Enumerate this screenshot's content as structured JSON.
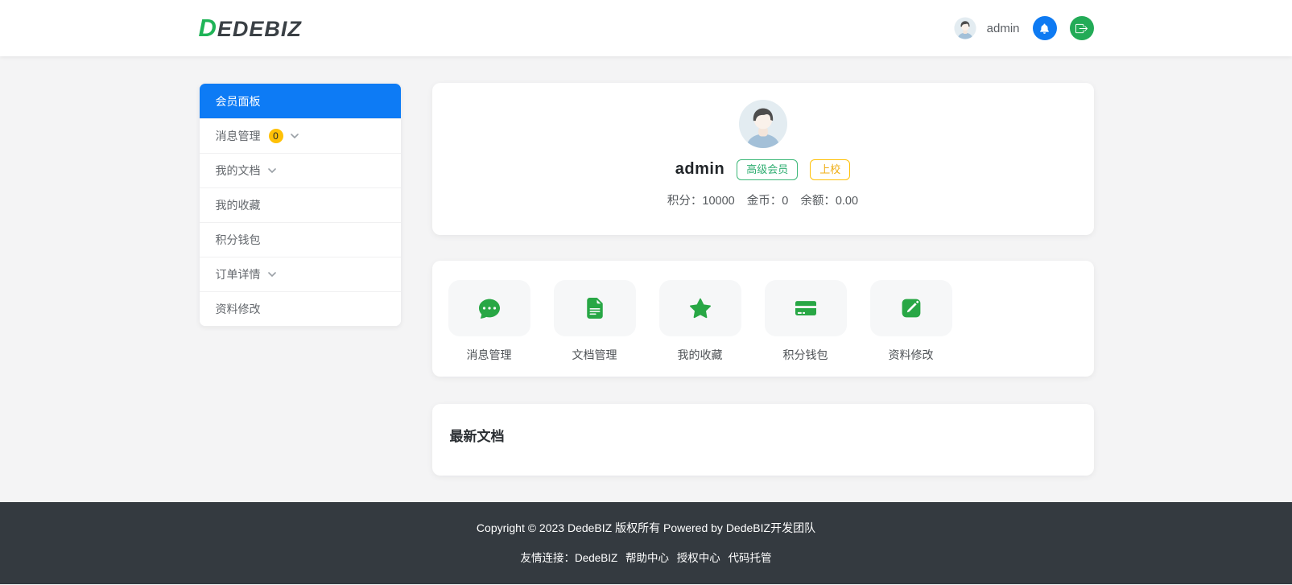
{
  "header": {
    "logo": {
      "d": "D",
      "rest": "EDEBIZ"
    },
    "username": "admin"
  },
  "sidebar": {
    "items": [
      {
        "label": "会员面板",
        "active": true
      },
      {
        "label": "消息管理",
        "badge": "0",
        "chevron": true
      },
      {
        "label": "我的文档",
        "chevron": true
      },
      {
        "label": "我的收藏"
      },
      {
        "label": "积分钱包"
      },
      {
        "label": "订单详情",
        "chevron": true
      },
      {
        "label": "资料修改"
      }
    ]
  },
  "profile": {
    "username": "admin",
    "badges": [
      {
        "label": "高级会员",
        "color": "#3cb878"
      },
      {
        "label": "上校",
        "color": "#ffc107"
      }
    ],
    "stats": [
      {
        "label": "积分：",
        "value": "10000"
      },
      {
        "label": "金币：",
        "value": "0"
      },
      {
        "label": "余额：",
        "value": "0.00"
      }
    ]
  },
  "shortcuts": [
    {
      "label": "消息管理",
      "icon": "chat-icon"
    },
    {
      "label": "文档管理",
      "icon": "document-icon"
    },
    {
      "label": "我的收藏",
      "icon": "star-icon"
    },
    {
      "label": "积分钱包",
      "icon": "credit-card-icon"
    },
    {
      "label": "资料修改",
      "icon": "edit-icon"
    }
  ],
  "latest_docs": {
    "title": "最新文档"
  },
  "footer": {
    "copyright": "Copyright © 2023 DedeBIZ 版权所有 Powered by DedeBIZ开发团队",
    "links_label": "友情连接：",
    "links": [
      "DedeBIZ",
      "帮助中心",
      "授权中心",
      "代码托管"
    ]
  },
  "colors": {
    "primary_blue": "#0d7bf5",
    "icon_green": "#28a745",
    "logout_green": "#23ab57",
    "logo_green": "#1fb457",
    "warning_yellow": "#ffc107",
    "footer_dark": "#343a40",
    "page_background": "#f4f4f5"
  }
}
